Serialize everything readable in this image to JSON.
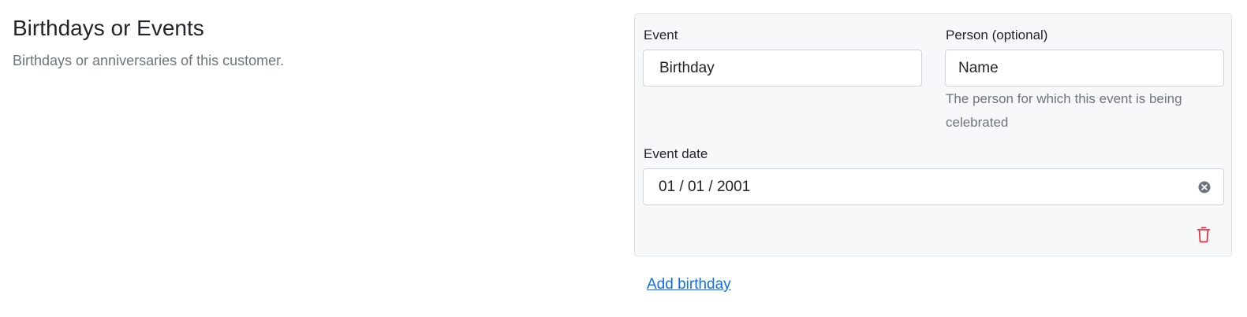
{
  "section": {
    "title": "Birthdays or Events",
    "description": "Birthdays or anniversaries of this customer."
  },
  "event_form": {
    "event": {
      "label": "Event",
      "value": "Birthday"
    },
    "person": {
      "label": "Person (optional)",
      "value": "Name",
      "help_line_1": "The person for which this event is being",
      "help_line_2": "celebrated"
    },
    "event_date": {
      "label": "Event date",
      "value": "01 / 01 / 2001",
      "clear_icon": "clear-circle-icon"
    },
    "delete_icon": "trash-icon",
    "colors": {
      "delete": "#dc3545",
      "card_background": "#f7f8f9"
    }
  },
  "actions": {
    "add_birthday_label": "Add birthday",
    "link_color": "#0d6efd"
  }
}
